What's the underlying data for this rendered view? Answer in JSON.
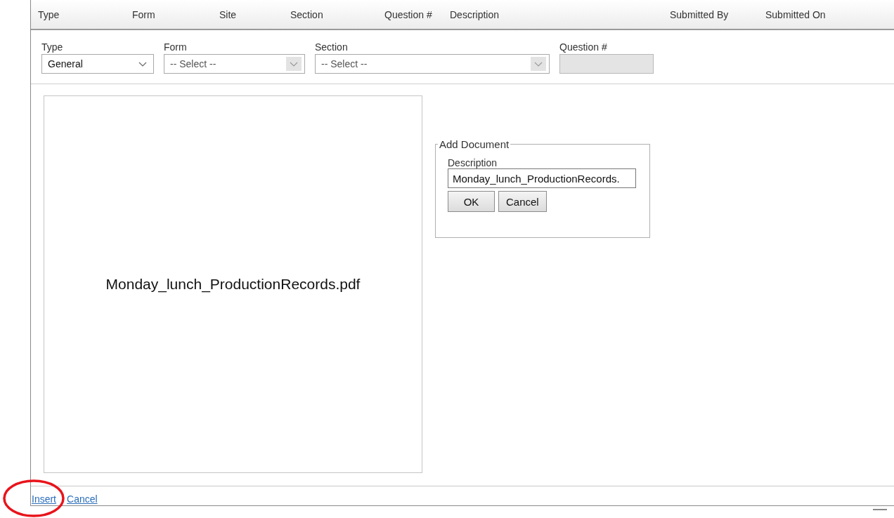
{
  "columns": [
    "Type",
    "Form",
    "Site",
    "Section",
    "Question #",
    "Description",
    "Submitted By",
    "Submitted On"
  ],
  "filters": [
    {
      "kind": "select",
      "label": "Type",
      "value": "General",
      "disabled": false
    },
    {
      "kind": "select",
      "label": "Form",
      "value": "-- Select --",
      "disabled": true
    },
    {
      "kind": "select",
      "label": "Section",
      "value": "-- Select --",
      "disabled": true
    },
    {
      "kind": "text",
      "label": "Question #",
      "disabled": true
    }
  ],
  "preview": {
    "file_name": "Monday_lunch_ProductionRecords.pdf"
  },
  "add_document": {
    "legend": "Add Document",
    "field_label": "Description",
    "value": "Monday_lunch_ProductionRecords.",
    "buttons": [
      "OK",
      "Cancel"
    ]
  },
  "footer_links": [
    "Insert",
    "Cancel"
  ],
  "annotation": {
    "kind": "ellipse",
    "color": "#e8141b"
  }
}
